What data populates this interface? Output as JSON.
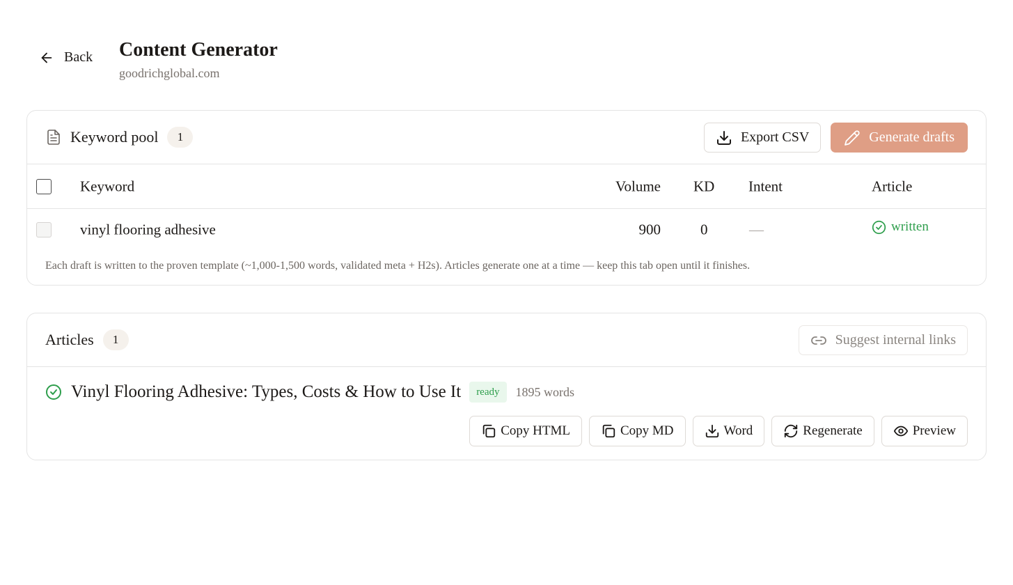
{
  "header": {
    "back_label": "Back",
    "title": "Content Generator",
    "domain": "goodrichglobal.com"
  },
  "keyword_pool": {
    "title": "Keyword pool",
    "count": "1",
    "export_label": "Export CSV",
    "generate_label": "Generate drafts",
    "columns": {
      "keyword": "Keyword",
      "volume": "Volume",
      "kd": "KD",
      "intent": "Intent",
      "article": "Article"
    },
    "rows": [
      {
        "keyword": "vinyl flooring adhesive",
        "volume": "900",
        "kd": "0",
        "intent": "—",
        "article": "written"
      }
    ],
    "note": "Each draft is written to the proven template (~1,000-1,500 words, validated meta + H2s). Articles generate one at a time — keep this tab open until it finishes."
  },
  "articles": {
    "title": "Articles",
    "count": "1",
    "suggest_label": "Suggest internal links",
    "items": [
      {
        "title": "Vinyl Flooring Adhesive: Types, Costs & How to Use It",
        "status": "ready",
        "words": "1895 words",
        "actions": {
          "copy_html": "Copy HTML",
          "copy_md": "Copy MD",
          "word": "Word",
          "regenerate": "Regenerate",
          "preview": "Preview"
        }
      }
    ]
  },
  "colors": {
    "accent": "#df9e85",
    "success": "#2e9e4c",
    "pill_bg": "#f5f1ec",
    "border": "#e4e4e4"
  }
}
